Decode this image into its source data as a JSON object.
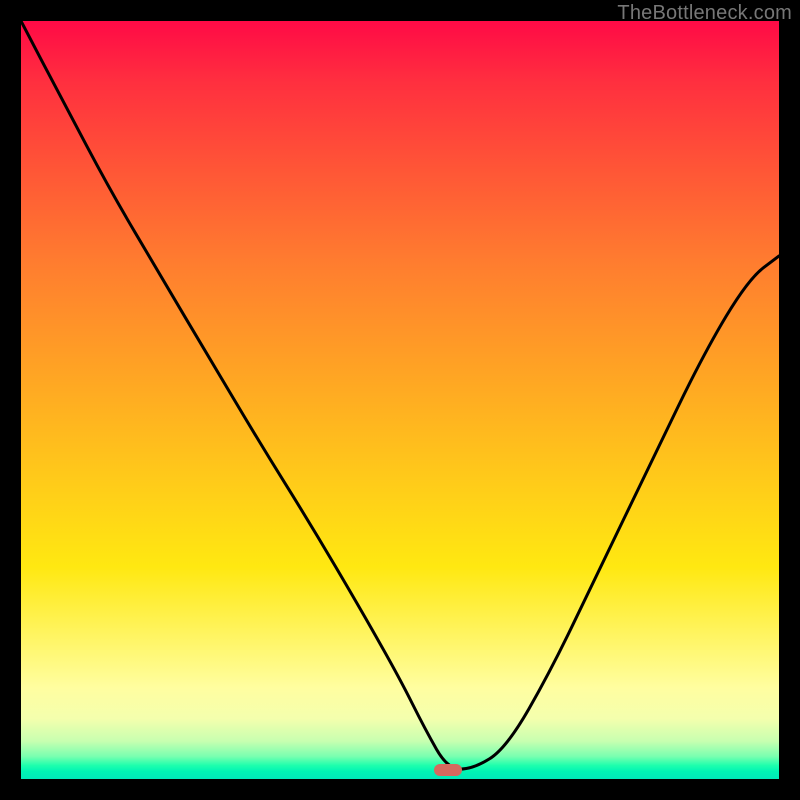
{
  "watermark": "TheBottleneck.com",
  "marker": {
    "x_frac": 0.563,
    "y_frac": 0.988,
    "color": "#d6695e"
  },
  "chart_data": {
    "type": "line",
    "title": "",
    "xlabel": "",
    "ylabel": "",
    "xlim": [
      0,
      1
    ],
    "ylim": [
      0,
      1
    ],
    "grid": false,
    "legend": false,
    "series": [
      {
        "name": "bottleneck-curve",
        "x": [
          0.0,
          0.055,
          0.118,
          0.184,
          0.25,
          0.316,
          0.382,
          0.448,
          0.5,
          0.533,
          0.563,
          0.596,
          0.64,
          0.7,
          0.76,
          0.83,
          0.9,
          0.96,
          1.0
        ],
        "y": [
          1.0,
          0.895,
          0.776,
          0.664,
          0.553,
          0.442,
          0.336,
          0.224,
          0.132,
          0.066,
          0.013,
          0.013,
          0.04,
          0.145,
          0.27,
          0.415,
          0.56,
          0.66,
          0.69
        ]
      }
    ],
    "annotations": [
      {
        "type": "marker",
        "shape": "pill",
        "x": 0.563,
        "y": 0.012,
        "color": "#d6695e"
      }
    ],
    "background_gradient": {
      "direction": "vertical",
      "stops": [
        {
          "pos": 0.0,
          "color": "#ff0a46"
        },
        {
          "pos": 0.5,
          "color": "#ffb020"
        },
        {
          "pos": 0.85,
          "color": "#fff66a"
        },
        {
          "pos": 0.97,
          "color": "#7affb0"
        },
        {
          "pos": 1.0,
          "color": "#00e8b9"
        }
      ]
    }
  }
}
